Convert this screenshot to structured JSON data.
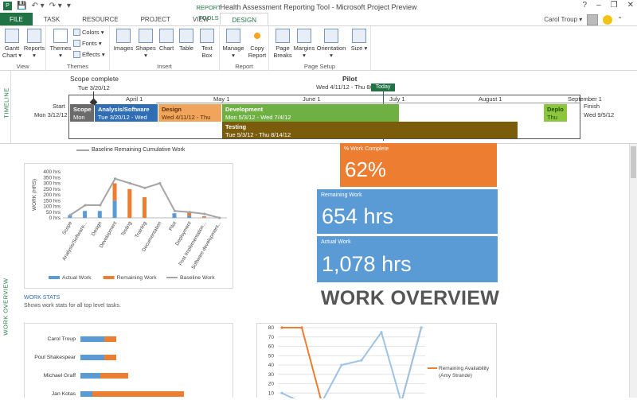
{
  "window": {
    "title": "Health Assessment Reporting Tool - Microsoft Project Preview",
    "context_tab_header": "REPORT TOOLS",
    "controls": [
      "?",
      "–",
      "❐",
      "✕"
    ]
  },
  "tabs": [
    {
      "label": "FILE"
    },
    {
      "label": "TASK"
    },
    {
      "label": "RESOURCE"
    },
    {
      "label": "PROJECT"
    },
    {
      "label": "VIEW"
    },
    {
      "label": "DESIGN"
    }
  ],
  "user": {
    "name": "Carol Troup ▾"
  },
  "ribbon": {
    "gantt_label": "Gantt Chart ▾",
    "reports_label": "Reports ▾",
    "view_group": "View",
    "themes_label": "Themes ▾",
    "colors_label": "Colors ▾",
    "fonts_label": "Fonts ▾",
    "effects_label": "Effects ▾",
    "themes_group": "Themes",
    "images_label": "Images",
    "shapes_label": "Shapes ▾",
    "chart_label": "Chart",
    "table_label": "Table",
    "textbox_label": "Text Box",
    "insert_group": "Insert",
    "manage_label": "Manage ▾",
    "copy_report_label": "Copy Report",
    "report_group": "Report",
    "page_breaks_label": "Page Breaks",
    "margins_label": "Margins ▾",
    "orientation_label": "Orientation ▾",
    "size_label": "Size ▾",
    "page_setup_group": "Page Setup"
  },
  "timeline": {
    "side_label": "TIMELINE",
    "scope_callout": "Scope complete",
    "scope_callout_date": "Tue 3/20/12",
    "pilot_label": "Pilot",
    "pilot_dates": "Wed 4/11/12 - Thu 8/2",
    "today_label": "Today",
    "start_label": "Start",
    "start_date": "Mon 3/12/12",
    "finish_label": "Finish",
    "finish_date": "Wed 9/5/12",
    "months": [
      "April 1",
      "May 1",
      "June 1",
      "July 1",
      "August 1",
      "September 1"
    ],
    "bars": [
      {
        "name": "Scope",
        "date": "Mon",
        "color": "#6b6b6b"
      },
      {
        "name": "Analysis/Software",
        "date": "Tue 3/20/12 - Wed",
        "color": "#2f6db5"
      },
      {
        "name": "Design",
        "date": "Wed 4/11/12 - Thu",
        "color": "#f0a45c"
      },
      {
        "name": "Development",
        "date": "Mon 5/3/12 - Wed 7/4/12",
        "color": "#6fb043"
      },
      {
        "name": "Deplo",
        "date": "Thu",
        "color": "#8cc63f"
      },
      {
        "name": "Testing",
        "date": "Tue 5/3/12 - Thu 8/14/12",
        "color": "#7b5c0b"
      }
    ]
  },
  "report": {
    "side_label": "WORK OVERVIEW",
    "legend_top_baseline": "Baseline Remaining Cumulative Work",
    "work_stats_title": "WORK STATS",
    "work_stats_desc": "Shows work stats for all top level tasks.",
    "big_title": "WORK OVERVIEW",
    "tiles": [
      {
        "label": "% Work Complete",
        "value": "62%",
        "color": "#ed7d31"
      },
      {
        "label": "Remaining Work",
        "value": "654 hrs",
        "color": "#5b9bd5"
      },
      {
        "label": "Actual Work",
        "value": "1,078 hrs",
        "color": "#5b9bd5"
      }
    ],
    "resources": [
      "Carol Troup",
      "Poul Shakespear",
      "Michael Graff",
      "Jan Kotas"
    ],
    "avail_legend": "Remaining Availability (Amy Strande)"
  },
  "chart_data": [
    {
      "type": "bar",
      "title": "",
      "ylabel": "WORK (HRS)",
      "ylim": [
        0,
        400
      ],
      "yticks": [
        "400 hrs",
        "350 hrs",
        "300 hrs",
        "250 hrs",
        "200 hrs",
        "150 hrs",
        "100 hrs",
        "50 hrs",
        "0 hrs"
      ],
      "categories": [
        "Scope",
        "Analysis/Software...",
        "Design",
        "Development",
        "Testing",
        "Training",
        "Documentation",
        "Pilot",
        "Deployment",
        "Post Implementation...",
        "Software development..."
      ],
      "series": [
        {
          "name": "Actual Work",
          "color": "#5b9bd5",
          "values": [
            25,
            60,
            60,
            150,
            0,
            0,
            0,
            40,
            20,
            5,
            0
          ]
        },
        {
          "name": "Remaining Work",
          "color": "#ed7d31",
          "values": [
            0,
            0,
            0,
            150,
            250,
            180,
            0,
            0,
            25,
            10,
            0
          ]
        },
        {
          "name": "Baseline Work",
          "color": "#a5a5a5",
          "values": [
            25,
            110,
            110,
            340,
            300,
            260,
            300,
            60,
            50,
            35,
            0
          ]
        }
      ]
    },
    {
      "type": "bar",
      "categories": [
        "Carol Troup",
        "Poul Shakespear",
        "Michael Graff",
        "Jan Kotas"
      ],
      "series": [
        {
          "name": "Actual",
          "color": "#5b9bd5",
          "values": [
            30,
            30,
            25,
            15
          ]
        },
        {
          "name": "Remaining",
          "color": "#ed7d31",
          "values": [
            15,
            15,
            35,
            115
          ]
        }
      ]
    },
    {
      "type": "line",
      "ylim": [
        0,
        80
      ],
      "yticks": [
        "80",
        "70",
        "60",
        "50",
        "40",
        "30",
        "20",
        "10",
        "0"
      ],
      "series": [
        {
          "name": "Remaining Availability (Amy Strande)",
          "color": "#ed7d31",
          "values": [
            80,
            80,
            0,
            0,
            0,
            0,
            0,
            80
          ]
        },
        {
          "name": "",
          "color": "#9dc3e6",
          "values": [
            10,
            0,
            0,
            40,
            45,
            75,
            0,
            80
          ]
        }
      ]
    }
  ]
}
